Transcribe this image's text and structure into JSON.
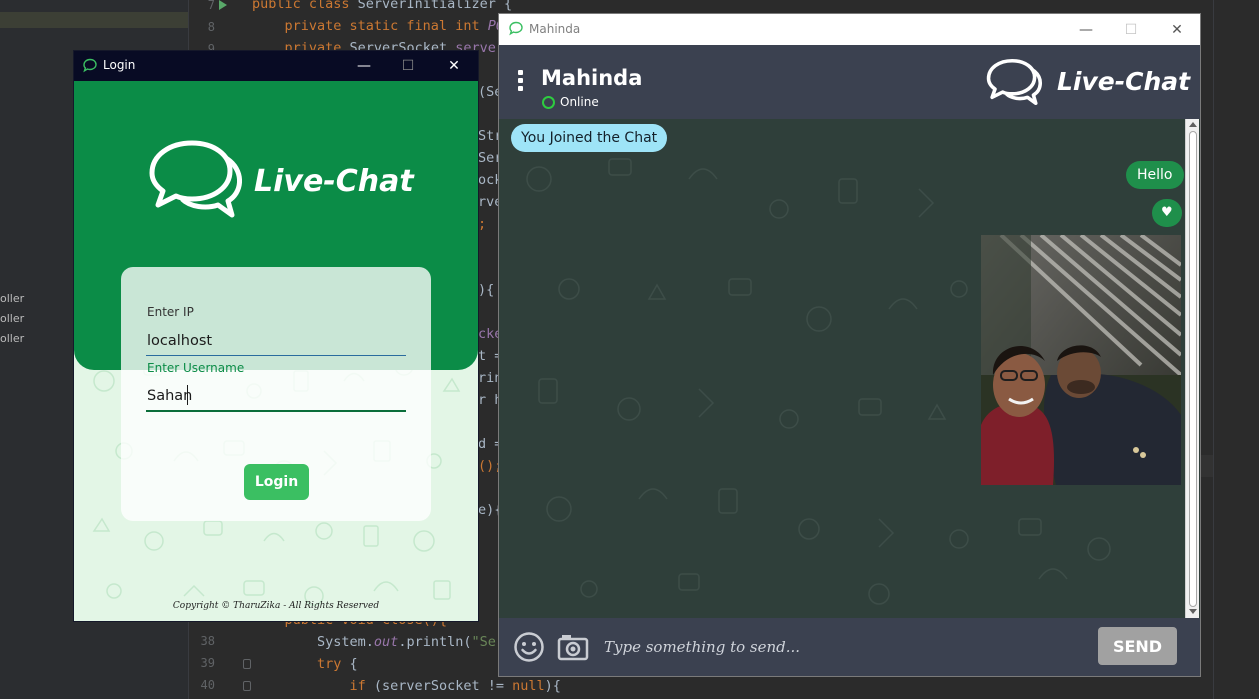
{
  "ide": {
    "line_numbers": [
      "7",
      "8",
      "9",
      "38",
      "39",
      "40"
    ],
    "side_items": [
      "oller",
      "oller",
      "oller"
    ],
    "code_lines": [
      {
        "segs": [
          {
            "t": "public class ",
            "c": "kw"
          },
          {
            "t": "ServerInitializer {",
            "c": ""
          }
        ]
      },
      {
        "segs": [
          {
            "t": "    private static final int ",
            "c": "kw"
          },
          {
            "t": "PO",
            "c": "it"
          }
        ]
      },
      {
        "segs": [
          {
            "t": "    private ",
            "c": "kw"
          },
          {
            "t": "ServerSocket ",
            "c": ""
          },
          {
            "t": "server",
            "c": "fld"
          }
        ]
      },
      {
        "segs": [
          {
            "t": "(Se",
            "c": ""
          }
        ]
      },
      {
        "segs": [
          {
            "t": "Str",
            "c": ""
          }
        ]
      },
      {
        "segs": [
          {
            "t": "Ser",
            "c": ""
          }
        ]
      },
      {
        "segs": [
          {
            "t": "ock",
            "c": ""
          }
        ]
      },
      {
        "segs": [
          {
            "t": "rve",
            "c": ""
          }
        ]
      },
      {
        "segs": [
          {
            "t": ";",
            "c": "kw"
          }
        ]
      },
      {
        "segs": [
          {
            "t": "){",
            "c": ""
          }
        ]
      },
      {
        "segs": [
          {
            "t": "cke",
            "c": "fld"
          }
        ]
      },
      {
        "segs": [
          {
            "t": "t =",
            "c": ""
          }
        ]
      },
      {
        "segs": [
          {
            "t": "rin",
            "c": ""
          }
        ]
      },
      {
        "segs": [
          {
            "t": "r h",
            "c": ""
          }
        ]
      },
      {
        "segs": [
          {
            "t": "d =",
            "c": ""
          }
        ]
      },
      {
        "segs": [
          {
            "t": "();",
            "c": "kw"
          }
        ]
      },
      {
        "segs": [
          {
            "t": "e){",
            "c": ""
          }
        ]
      },
      {
        "segs": [
          {
            "t": "    public void close(){",
            "c": "kw"
          }
        ]
      },
      {
        "segs": [
          {
            "t": "        System.",
            "c": ""
          },
          {
            "t": "out",
            "c": "it"
          },
          {
            "t": ".println(",
            "c": ""
          },
          {
            "t": "\"Ser",
            "c": "str"
          }
        ]
      },
      {
        "segs": [
          {
            "t": "        try ",
            "c": "kw"
          },
          {
            "t": "{",
            "c": ""
          }
        ]
      },
      {
        "segs": [
          {
            "t": "            if ",
            "c": "kw"
          },
          {
            "t": "(serverSocket != ",
            "c": ""
          },
          {
            "t": "null",
            "c": "kw"
          },
          {
            "t": "){",
            "c": ""
          }
        ]
      }
    ]
  },
  "login_window": {
    "title": "Login",
    "brand": "Live-Chat",
    "ip_label": "Enter IP",
    "ip_value": "localhost",
    "username_label": "Enter Username",
    "username_value": "Sahan",
    "login_button": "Login",
    "copyright": "Copyright © TharuZika - All Rights Reserved",
    "controls": {
      "minimize": "—",
      "maximize": "☐",
      "close": "✕"
    }
  },
  "chat_window": {
    "title": "Mahinda",
    "contact_name": "Mahinda",
    "status": "Online",
    "brand": "Live-Chat",
    "messages": {
      "system": "You Joined the Chat",
      "hello": "Hello",
      "heart": "♥"
    },
    "input_placeholder": "Type something to send...",
    "send_button": "SEND",
    "controls": {
      "minimize": "—",
      "maximize": "☐",
      "close": "✕"
    }
  },
  "colors": {
    "login_green": "#0b8c47",
    "chat_header": "#3b4150",
    "chat_bg": "#2f3f3a",
    "system_bubble": "#9ee4f7",
    "outgoing_bubble": "#1f8f4b",
    "login_button": "#3bbf62",
    "online": "#2ecc40"
  }
}
